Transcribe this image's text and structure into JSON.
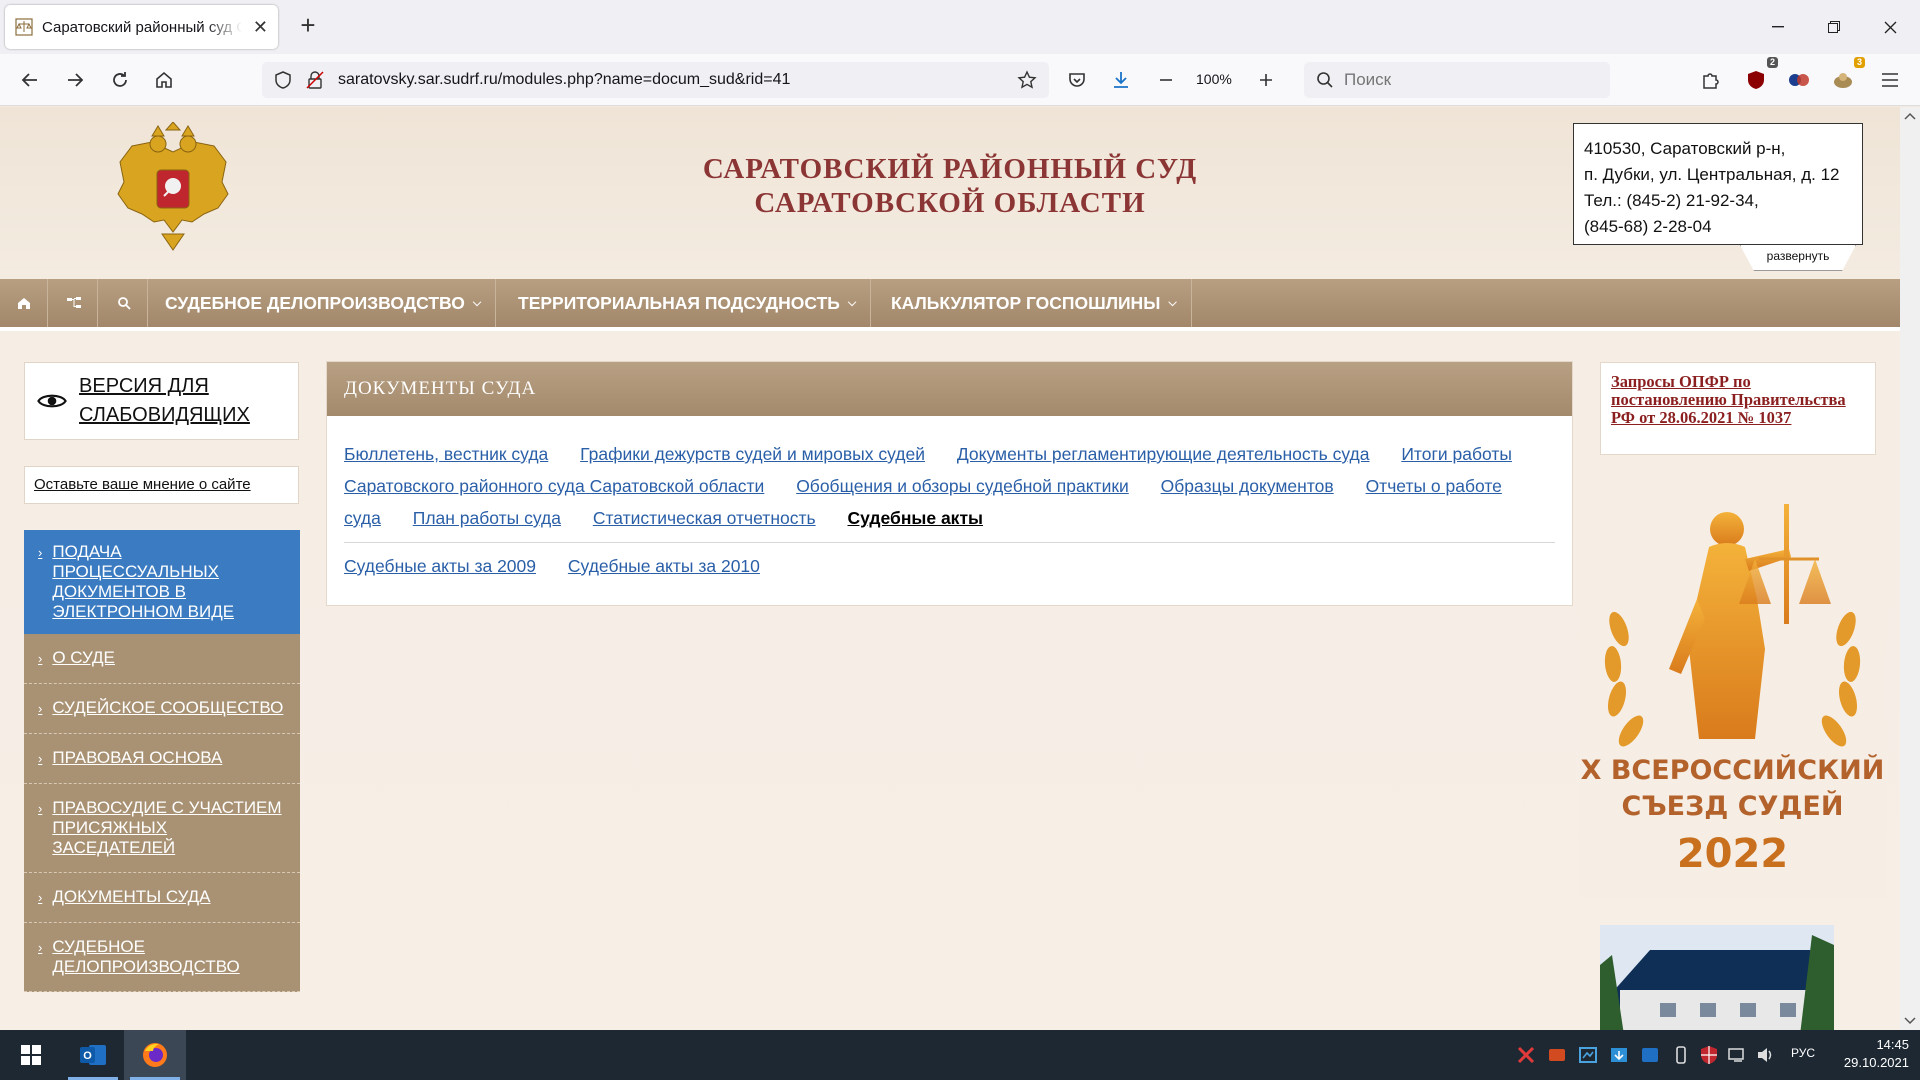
{
  "browser": {
    "tab_title": "Саратовский районный суд Саратовской области",
    "url": "saratovsky.sar.sudrf.ru/modules.php?name=docum_sud&rid=41",
    "zoom": "100%",
    "search_placeholder": "Поиск",
    "ext_badge_1": "2",
    "ext_badge_2": "3"
  },
  "header": {
    "title_line1": "САРАТОВСКИЙ РАЙОННЫЙ СУД",
    "title_line2": "САРАТОВСКОЙ ОБЛАСТИ",
    "address": [
      "410530, Саратовский р-н,",
      "п. Дубки, ул. Центральная, д. 12",
      "Тел.: (845-2) 21-92-34,",
      "(845-68) 2-28-04"
    ],
    "expand_label": "развернуть"
  },
  "menu": {
    "items": [
      {
        "label": "СУДЕБНОЕ ДЕЛОПРОИЗВОДСТВО"
      },
      {
        "label": "ТЕРРИТОРИАЛЬНАЯ ПОДСУДНОСТЬ"
      },
      {
        "label": "КАЛЬКУЛЯТОР ГОСПОШЛИНЫ"
      }
    ]
  },
  "sidebar": {
    "low_vision": "ВЕРСИЯ ДЛЯ СЛАБОВИДЯЩИХ",
    "opinion": "Оставьте ваше мнение о сайте",
    "items": [
      {
        "label": "ПОДАЧА ПРОЦЕССУАЛЬНЫХ ДОКУМЕНТОВ В ЭЛЕКТРОННОМ ВИДЕ"
      },
      {
        "label": "О СУДЕ"
      },
      {
        "label": "СУДЕЙСКОЕ СООБЩЕСТВО"
      },
      {
        "label": "ПРАВОВАЯ ОСНОВА"
      },
      {
        "label": "ПРАВОСУДИЕ С УЧАСТИЕМ ПРИСЯЖНЫХ ЗАСЕДАТЕЛЕЙ"
      },
      {
        "label": "ДОКУМЕНТЫ СУДА"
      },
      {
        "label": "СУДЕБНОЕ ДЕЛОПРОИЗВОДСТВО"
      }
    ]
  },
  "content": {
    "heading": "ДОКУМЕНТЫ СУДА",
    "links": [
      {
        "label": "Бюллетень, вестник суда"
      },
      {
        "label": "Графики дежурств судей и мировых судей"
      },
      {
        "label": "Документы регламентирующие деятельность суда"
      },
      {
        "label": "Итоги работы Саратовского районного суда Саратовской области"
      },
      {
        "label": "Обобщения и обзоры судебной практики"
      },
      {
        "label": "Образцы документов"
      },
      {
        "label": "Отчеты о работе суда"
      },
      {
        "label": "План работы суда"
      },
      {
        "label": "Статистическая отчетность"
      },
      {
        "label": "Судебные акты"
      }
    ],
    "sub_links": [
      {
        "label": "Судебные акты за 2009"
      },
      {
        "label": "Судебные акты за 2010"
      }
    ]
  },
  "right": {
    "opfr_link": "Запросы ОПФР по постановлению Правительства РФ от 28.06.2021 № 1037",
    "banner_line1": "X ВСЕРОССИЙСКИЙ",
    "banner_line2": "СЪЕЗД СУДЕЙ",
    "banner_year": "2022"
  },
  "taskbar": {
    "time": "14:45",
    "date": "29.10.2021",
    "lang": "РУС"
  }
}
